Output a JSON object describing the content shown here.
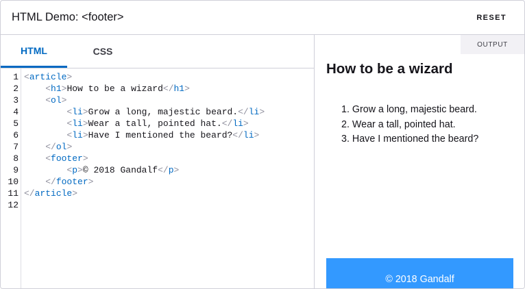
{
  "header": {
    "title": "HTML Demo: <footer>",
    "reset_label": "RESET"
  },
  "tabs": [
    {
      "label": "HTML",
      "active": true
    },
    {
      "label": "CSS",
      "active": false
    }
  ],
  "code": {
    "line_numbers": [
      "1",
      "2",
      "3",
      "4",
      "5",
      "6",
      "7",
      "8",
      "9",
      "10",
      "11",
      "12"
    ],
    "lines": [
      [
        {
          "t": "ang",
          "v": "<"
        },
        {
          "t": "tag",
          "v": "article"
        },
        {
          "t": "ang",
          "v": ">"
        }
      ],
      [
        {
          "t": "txt",
          "v": "    "
        },
        {
          "t": "ang",
          "v": "<"
        },
        {
          "t": "tag",
          "v": "h1"
        },
        {
          "t": "ang",
          "v": ">"
        },
        {
          "t": "txt",
          "v": "How to be a wizard"
        },
        {
          "t": "ang",
          "v": "</"
        },
        {
          "t": "tag",
          "v": "h1"
        },
        {
          "t": "ang",
          "v": ">"
        }
      ],
      [
        {
          "t": "txt",
          "v": "    "
        },
        {
          "t": "ang",
          "v": "<"
        },
        {
          "t": "tag",
          "v": "ol"
        },
        {
          "t": "ang",
          "v": ">"
        }
      ],
      [
        {
          "t": "txt",
          "v": "        "
        },
        {
          "t": "ang",
          "v": "<"
        },
        {
          "t": "tag",
          "v": "li"
        },
        {
          "t": "ang",
          "v": ">"
        },
        {
          "t": "txt",
          "v": "Grow a long, majestic beard."
        },
        {
          "t": "ang",
          "v": "</"
        },
        {
          "t": "tag",
          "v": "li"
        },
        {
          "t": "ang",
          "v": ">"
        }
      ],
      [
        {
          "t": "txt",
          "v": "        "
        },
        {
          "t": "ang",
          "v": "<"
        },
        {
          "t": "tag",
          "v": "li"
        },
        {
          "t": "ang",
          "v": ">"
        },
        {
          "t": "txt",
          "v": "Wear a tall, pointed hat."
        },
        {
          "t": "ang",
          "v": "</"
        },
        {
          "t": "tag",
          "v": "li"
        },
        {
          "t": "ang",
          "v": ">"
        }
      ],
      [
        {
          "t": "txt",
          "v": "        "
        },
        {
          "t": "ang",
          "v": "<"
        },
        {
          "t": "tag",
          "v": "li"
        },
        {
          "t": "ang",
          "v": ">"
        },
        {
          "t": "txt",
          "v": "Have I mentioned the beard?"
        },
        {
          "t": "ang",
          "v": "</"
        },
        {
          "t": "tag",
          "v": "li"
        },
        {
          "t": "ang",
          "v": ">"
        }
      ],
      [
        {
          "t": "txt",
          "v": "    "
        },
        {
          "t": "ang",
          "v": "</"
        },
        {
          "t": "tag",
          "v": "ol"
        },
        {
          "t": "ang",
          "v": ">"
        }
      ],
      [
        {
          "t": "txt",
          "v": "    "
        },
        {
          "t": "ang",
          "v": "<"
        },
        {
          "t": "tag",
          "v": "footer"
        },
        {
          "t": "ang",
          "v": ">"
        }
      ],
      [
        {
          "t": "txt",
          "v": "        "
        },
        {
          "t": "ang",
          "v": "<"
        },
        {
          "t": "tag",
          "v": "p"
        },
        {
          "t": "ang",
          "v": ">"
        },
        {
          "t": "txt",
          "v": "© 2018 Gandalf"
        },
        {
          "t": "ang",
          "v": "</"
        },
        {
          "t": "tag",
          "v": "p"
        },
        {
          "t": "ang",
          "v": ">"
        }
      ],
      [
        {
          "t": "txt",
          "v": "    "
        },
        {
          "t": "ang",
          "v": "</"
        },
        {
          "t": "tag",
          "v": "footer"
        },
        {
          "t": "ang",
          "v": ">"
        }
      ],
      [
        {
          "t": "ang",
          "v": "</"
        },
        {
          "t": "tag",
          "v": "article"
        },
        {
          "t": "ang",
          "v": ">"
        }
      ],
      []
    ]
  },
  "output": {
    "label": "OUTPUT",
    "heading": "How to be a wizard",
    "list": [
      "1. Grow a long, majestic beard.",
      "2. Wear a tall, pointed hat.",
      "3. Have I mentioned the beard?"
    ],
    "footer_text": "© 2018 Gandalf"
  },
  "colors": {
    "accent": "#0069c2",
    "footer_bg": "#3399ff",
    "border": "#cfcfd8"
  }
}
